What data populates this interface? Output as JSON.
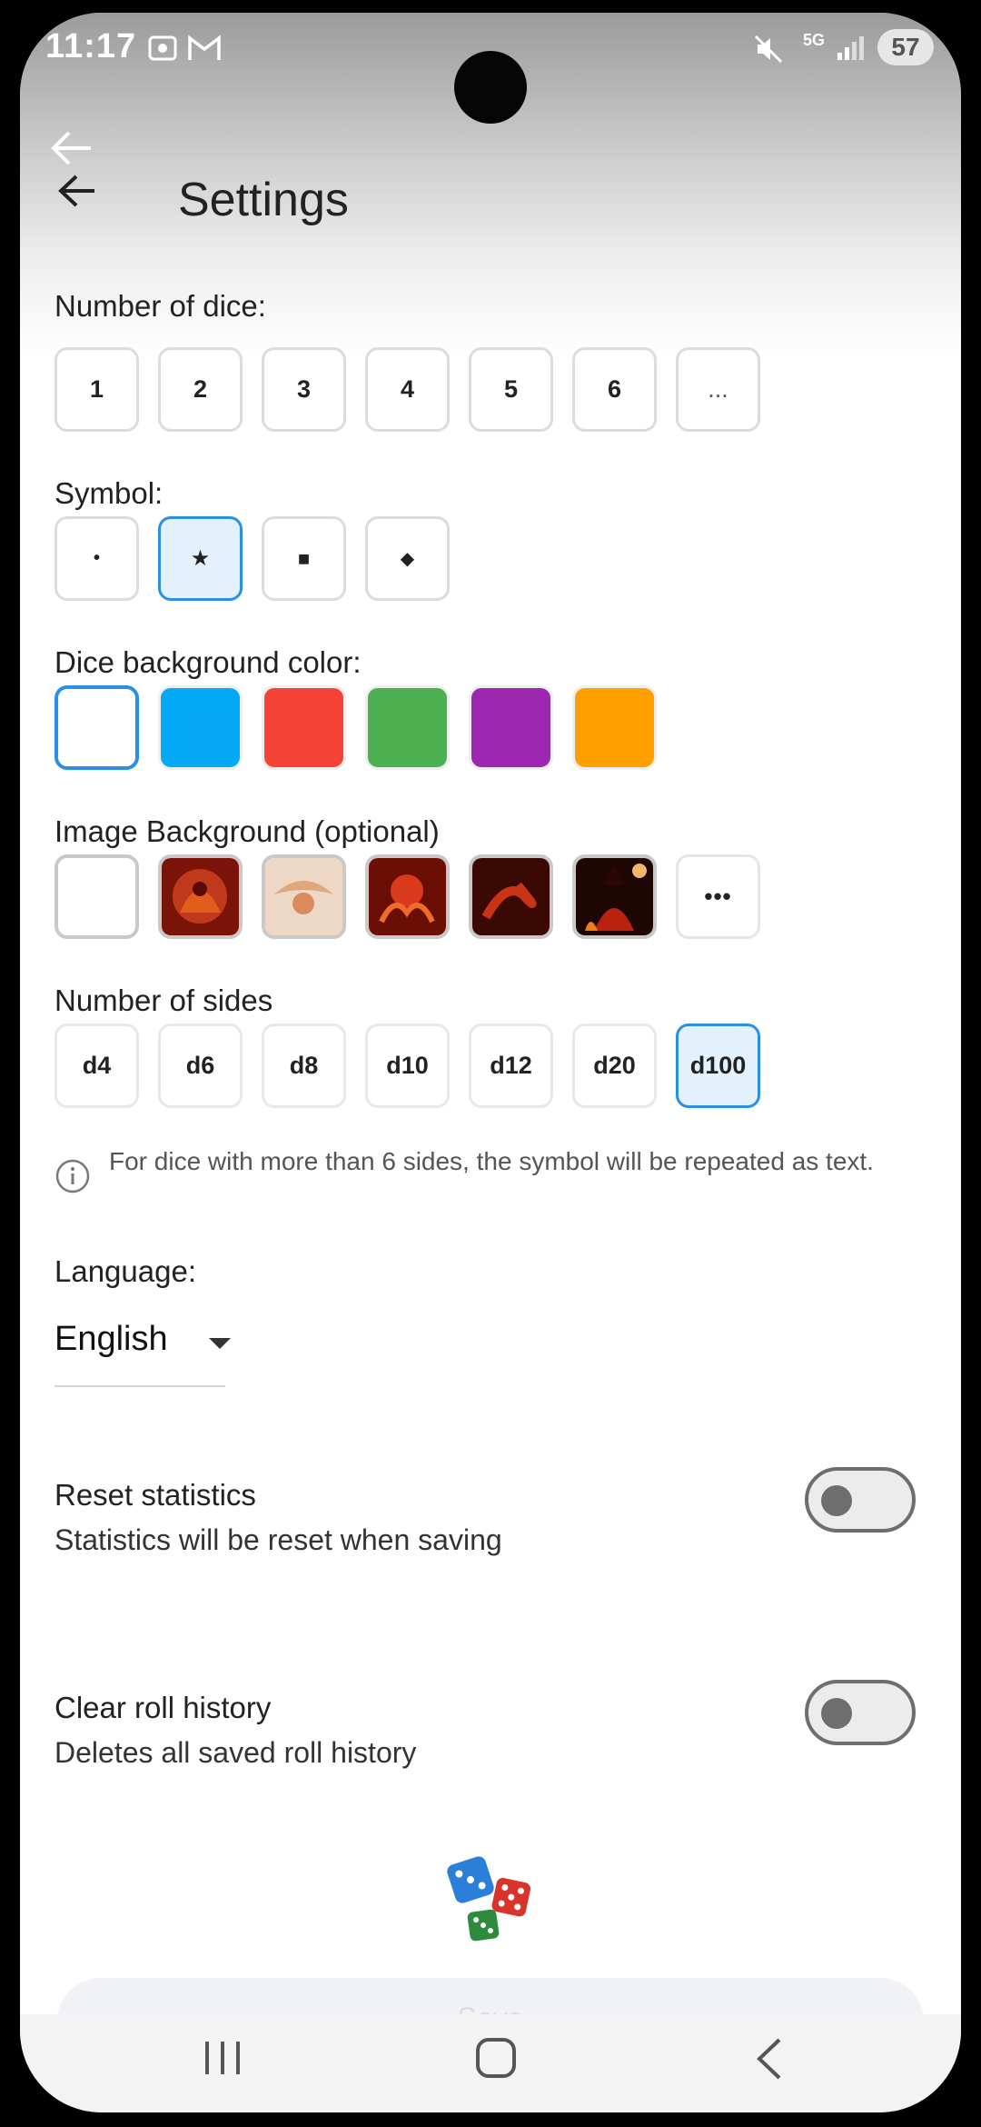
{
  "status_bar": {
    "time": "11:17",
    "network": "5G",
    "battery": "57"
  },
  "header": {
    "title": "Settings"
  },
  "dice_count": {
    "label": "Number of dice:",
    "options": [
      "1",
      "2",
      "3",
      "4",
      "5",
      "6",
      "..."
    ]
  },
  "symbol": {
    "label": "Symbol:",
    "options": [
      "•",
      "★",
      "■",
      "◆"
    ],
    "selected": "★"
  },
  "dice_bg": {
    "label": "Dice background color:",
    "colors": [
      "#ffffff",
      "#03a9f4",
      "#f44336",
      "#4caf50",
      "#9c27b0",
      "#ffa000"
    ],
    "selected": "#ffffff"
  },
  "image_bg": {
    "label": "Image Background (optional)",
    "more": "•••"
  },
  "sides": {
    "label": "Number of sides",
    "options": [
      "d4",
      "d6",
      "d8",
      "d10",
      "d12",
      "d20",
      "d100"
    ],
    "selected": "d100"
  },
  "info": {
    "text": "For dice with more than 6 sides, the symbol will be repeated as text."
  },
  "language": {
    "label": "Language:",
    "value": "English"
  },
  "reset_stats": {
    "title": "Reset statistics",
    "subtitle": "Statistics will be reset when saving",
    "on": false
  },
  "clear_history": {
    "title": "Clear roll history",
    "subtitle": "Deletes all saved roll history",
    "on": false
  },
  "save": {
    "label": "Save"
  }
}
